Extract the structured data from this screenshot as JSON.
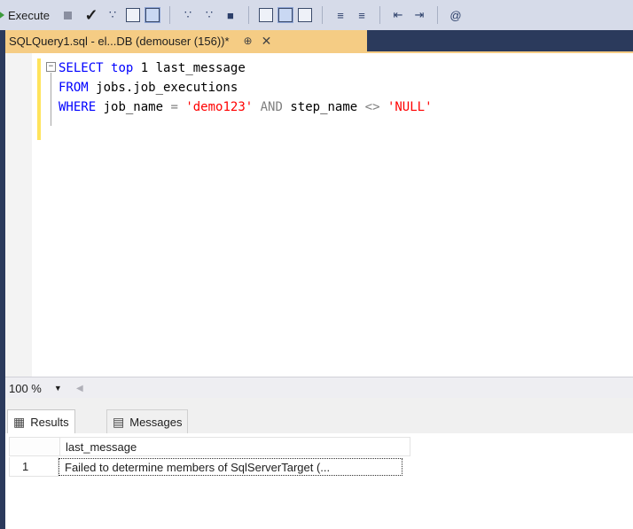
{
  "toolbar": {
    "execute_label": "Execute"
  },
  "tab": {
    "title": "SQLQuery1.sql - el...DB (demouser (156))*",
    "pin_glyph": "⊕",
    "close_glyph": "✕"
  },
  "editor": {
    "lines": [
      {
        "kw1": "SELECT",
        "kw2": "top",
        "rest": " 1 last_message"
      },
      {
        "kw1": "FROM",
        "rest": " jobs.job_executions"
      },
      {
        "kw1": "WHERE",
        "mid": " job_name ",
        "op1": "=",
        "str1": "'demo123'",
        "and": "AND",
        "mid2": " step_name ",
        "op2": "<>",
        "str2": "'NULL'"
      }
    ]
  },
  "zoom": {
    "level": "100 %"
  },
  "results": {
    "tabs": [
      {
        "label": "Results",
        "icon": "grid-icon"
      },
      {
        "label": "Messages",
        "icon": "messages-icon"
      }
    ],
    "columns": [
      "last_message"
    ],
    "rows": [
      {
        "num": "1",
        "values": [
          "Failed to determine members of SqlServerTarget (..."
        ]
      }
    ]
  },
  "colors": {
    "tab_active": "#f5cc84",
    "keyword": "#0000ff",
    "string": "#ff0000",
    "operator": "#808080"
  }
}
